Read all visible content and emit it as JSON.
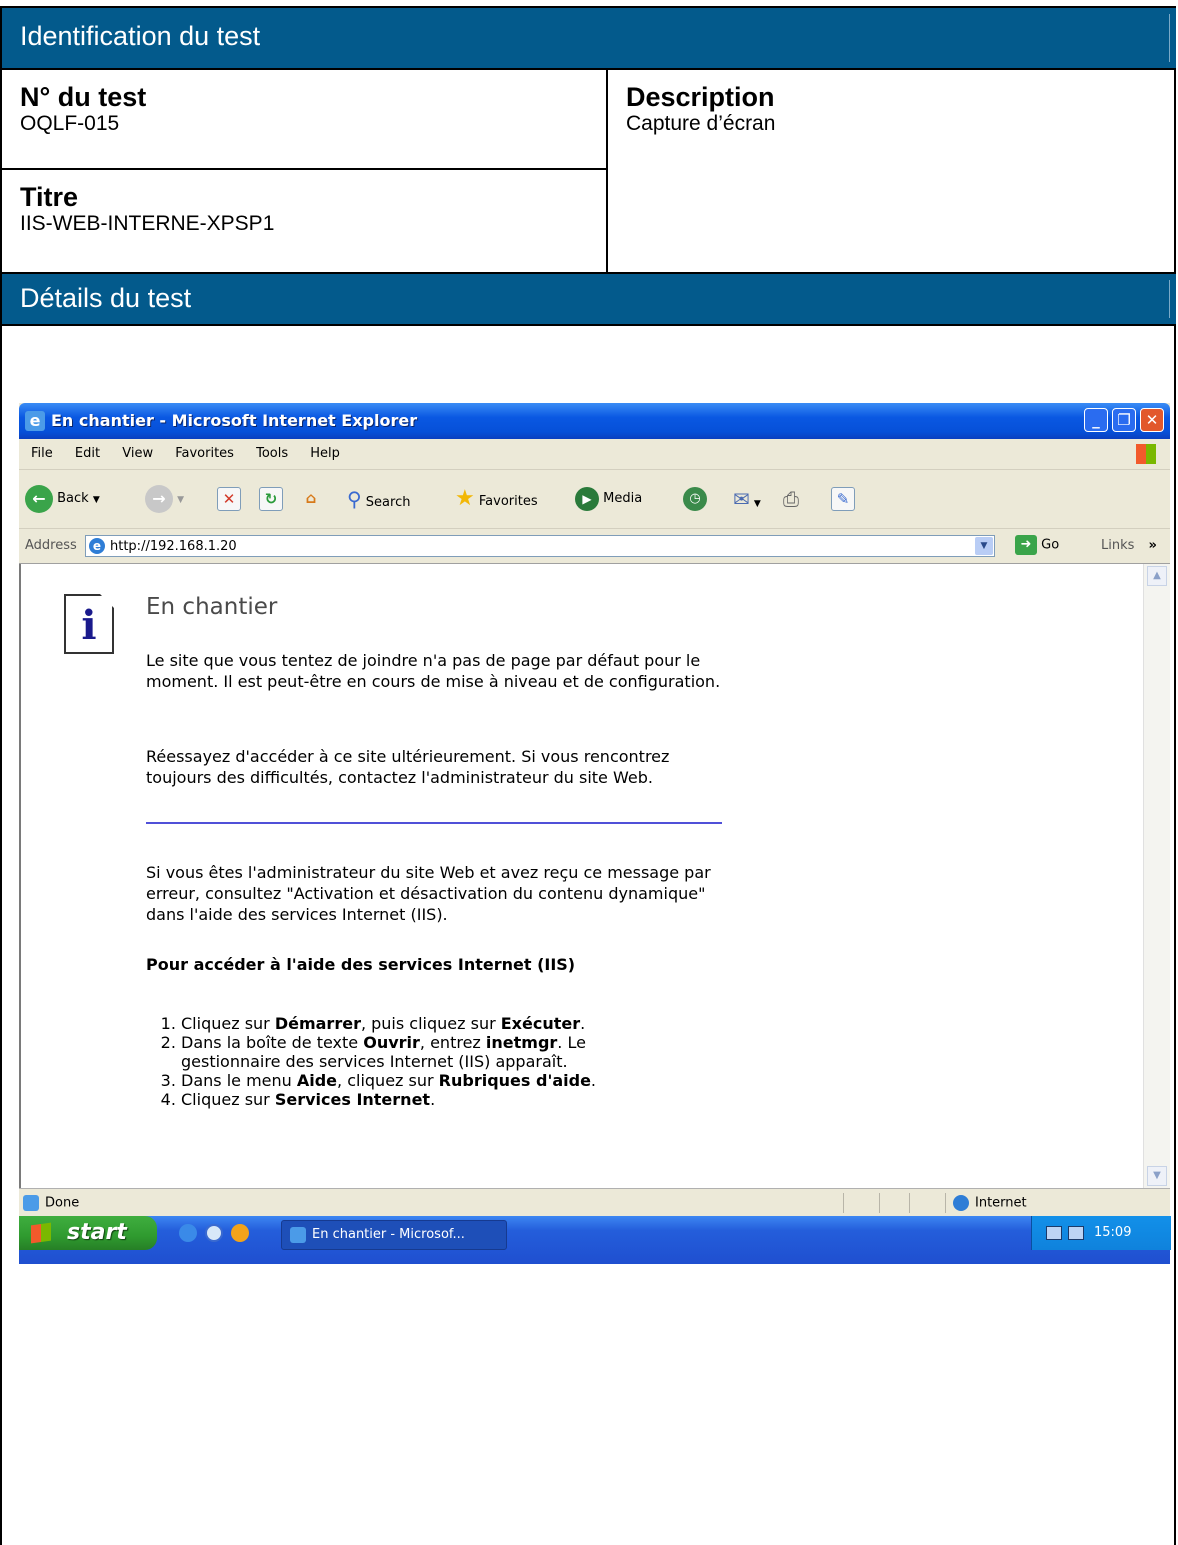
{
  "doc": {
    "header1": "Identification du test",
    "test_no_label": "N° du test",
    "test_no_value": "OQLF-015",
    "description_label": "Description",
    "description_value": "Capture d’écran",
    "title_label": "Titre",
    "title_value": "IIS-WEB-INTERNE-XPSP1",
    "header2": "Détails du test"
  },
  "window": {
    "title": "En chantier - Microsoft Internet Explorer",
    "menu": [
      "File",
      "Edit",
      "View",
      "Favorites",
      "Tools",
      "Help"
    ],
    "toolbar": {
      "back": "Back",
      "search": "Search",
      "favorites": "Favorites",
      "media": "Media"
    },
    "address_label": "Address",
    "address_value": "http://192.168.1.20",
    "go_label": "Go",
    "links_label": "Links",
    "links_more": "»"
  },
  "page": {
    "heading": "En chantier",
    "para1": "Le site que vous tentez de joindre n'a pas de page par défaut pour le moment. Il est peut-être en cours de mise à niveau et de configuration.",
    "para2": "Réessayez d'accéder à ce site ultérieurement. Si vous rencontrez toujours des difficultés, contactez l'administrateur du site Web.",
    "para3": "Si vous êtes l'administrateur du site Web et avez reçu ce message par erreur, consultez \"Activation et désactivation du contenu dynamique\" dans l'aide des services Internet (IIS).",
    "help_heading": "Pour accéder à l'aide des services Internet (IIS)",
    "steps": [
      {
        "pre": "Cliquez sur ",
        "b1": "Démarrer",
        "mid": ", puis cliquez sur ",
        "b2": "Exécuter",
        "post": "."
      },
      {
        "pre": "Dans la boîte de texte ",
        "b1": "Ouvrir",
        "mid": ", entrez ",
        "b2": "inetmgr",
        "post": ". Le gestionnaire des services Internet (IIS) apparaît."
      },
      {
        "pre": "Dans le menu ",
        "b1": "Aide",
        "mid": ", cliquez sur ",
        "b2": "Rubriques d'aide",
        "post": "."
      },
      {
        "pre": "Cliquez sur ",
        "b1": "Services Internet",
        "mid": "",
        "b2": "",
        "post": "."
      }
    ]
  },
  "status": {
    "left": "Done",
    "zone": "Internet"
  },
  "taskbar": {
    "start": "start",
    "task": "En chantier - Microsof...",
    "clock": "15:09"
  }
}
